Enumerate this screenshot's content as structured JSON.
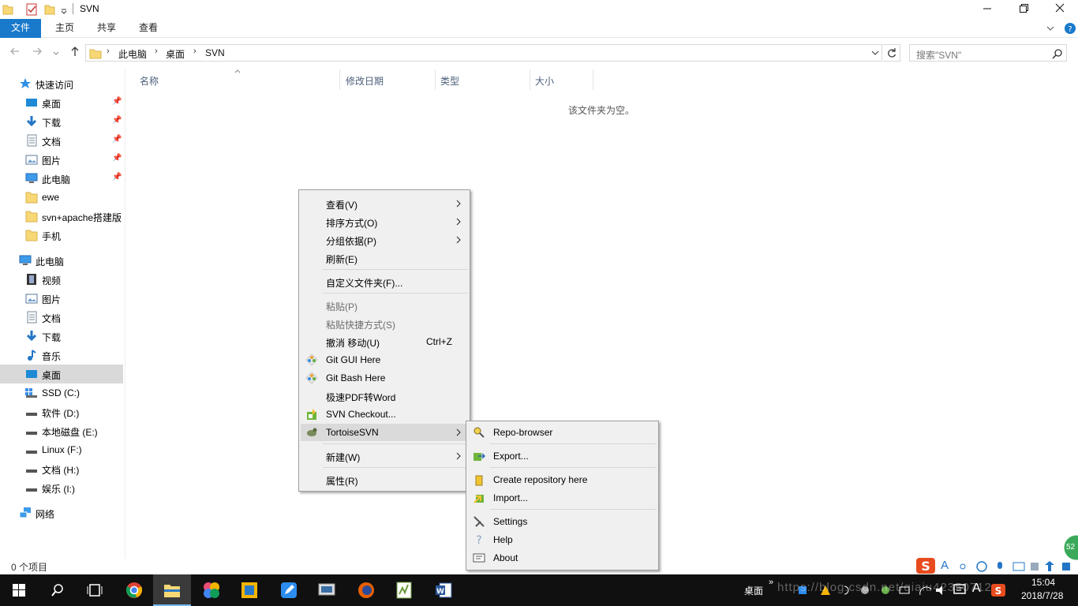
{
  "window": {
    "title": "SVN"
  },
  "ribbon": {
    "tabs": [
      "文件",
      "主页",
      "共享",
      "查看"
    ]
  },
  "address": {
    "crumbs": [
      "此电脑",
      "桌面",
      "SVN"
    ],
    "search_placeholder": "搜索\"SVN\""
  },
  "nav": {
    "quick_access": "快速访问",
    "quick_items": [
      "桌面",
      "下载",
      "文档",
      "图片",
      "此电脑",
      "ewe",
      "svn+apache搭建版",
      "手机"
    ],
    "this_pc": "此电脑",
    "pc_items": [
      "视频",
      "图片",
      "文档",
      "下载",
      "音乐",
      "桌面",
      "SSD (C:)",
      "软件 (D:)",
      "本地磁盘 (E:)",
      "Linux (F:)",
      "文档 (H:)",
      "娱乐 (I:)"
    ],
    "network": "网络"
  },
  "columns": [
    "名称",
    "修改日期",
    "类型",
    "大小"
  ],
  "empty_message": "该文件夹为空。",
  "status": "0 个项目",
  "context_menu": {
    "view": "查看(V)",
    "sort": "排序方式(O)",
    "group": "分组依据(P)",
    "refresh": "刷新(E)",
    "customize": "自定义文件夹(F)...",
    "paste": "粘贴(P)",
    "paste_shortcut": "粘贴快捷方式(S)",
    "undo": "撤消 移动(U)",
    "undo_shortcut": "Ctrl+Z",
    "git_gui": "Git GUI Here",
    "git_bash": "Git Bash Here",
    "pdf": "极速PDF转Word",
    "svn_checkout": "SVN Checkout...",
    "tortoise": "TortoiseSVN",
    "new": "新建(W)",
    "properties": "属性(R)"
  },
  "submenu": {
    "repo_browser": "Repo-browser",
    "export": "Export...",
    "create_repo": "Create repository here",
    "import": "Import...",
    "settings": "Settings",
    "help": "Help",
    "about": "About"
  },
  "taskbar": {
    "desktop_label": "桌面",
    "time": "15:04",
    "date": "2018/7/28",
    "badge": "52",
    "ime_lang": "A",
    "watermark": "https://blog.csdn.net/qiaiu42350712"
  },
  "colors": {
    "accent": "#1979ca",
    "taskbar": "#101010",
    "selection": "#d9d9d9"
  }
}
